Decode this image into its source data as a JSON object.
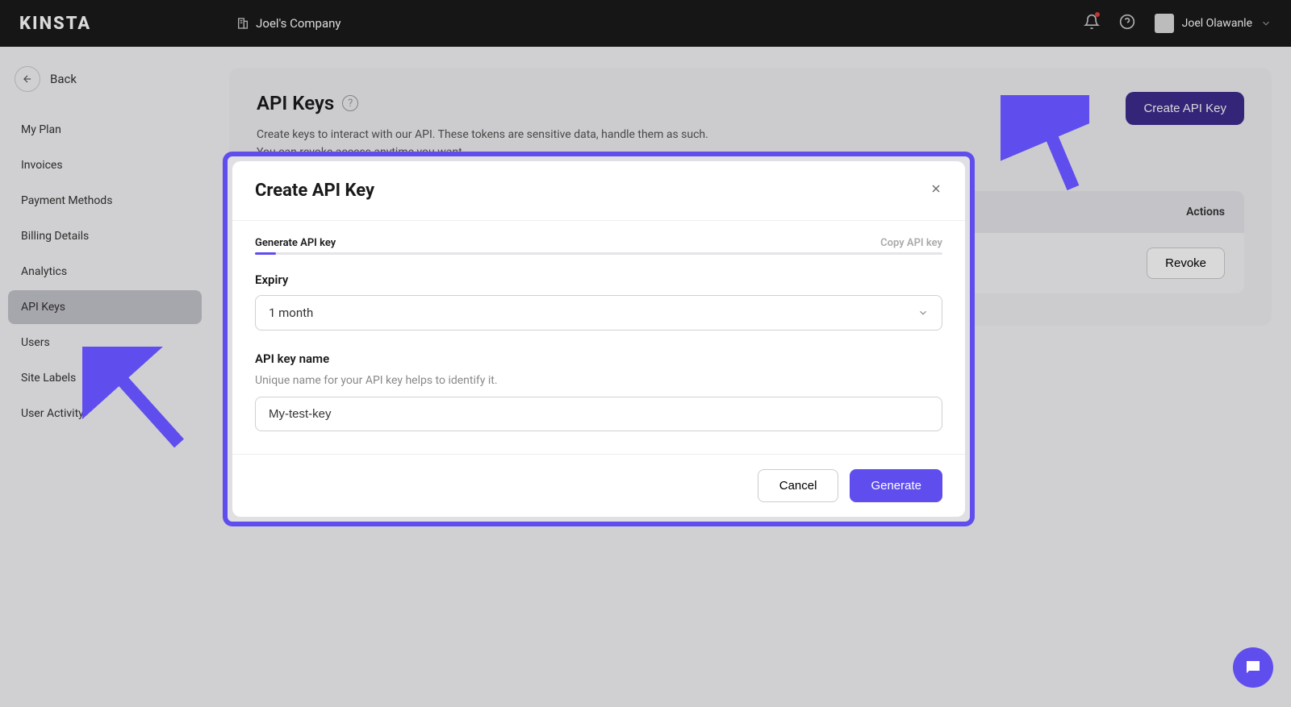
{
  "header": {
    "logo": "KINSTA",
    "company": "Joel's Company",
    "user_name": "Joel Olawanle"
  },
  "sidebar": {
    "back_label": "Back",
    "items": [
      {
        "label": "My Plan"
      },
      {
        "label": "Invoices"
      },
      {
        "label": "Payment Methods"
      },
      {
        "label": "Billing Details"
      },
      {
        "label": "Analytics"
      },
      {
        "label": "API Keys"
      },
      {
        "label": "Users"
      },
      {
        "label": "Site Labels"
      },
      {
        "label": "User Activity"
      }
    ]
  },
  "page": {
    "title": "API Keys",
    "description_line1": "Create keys to interact with our API. These tokens are sensitive data, handle them as such.",
    "description_line2": "You can revoke access anytime you want.",
    "create_button": "Create API Key",
    "table": {
      "actions_header": "Actions",
      "revoke_label": "Revoke"
    }
  },
  "modal": {
    "title": "Create API Key",
    "step1": "Generate API key",
    "step2": "Copy API key",
    "expiry_label": "Expiry",
    "expiry_value": "1 month",
    "name_label": "API key name",
    "name_help": "Unique name for your API key helps to identify it.",
    "name_value": "My-test-key",
    "cancel_label": "Cancel",
    "generate_label": "Generate"
  }
}
